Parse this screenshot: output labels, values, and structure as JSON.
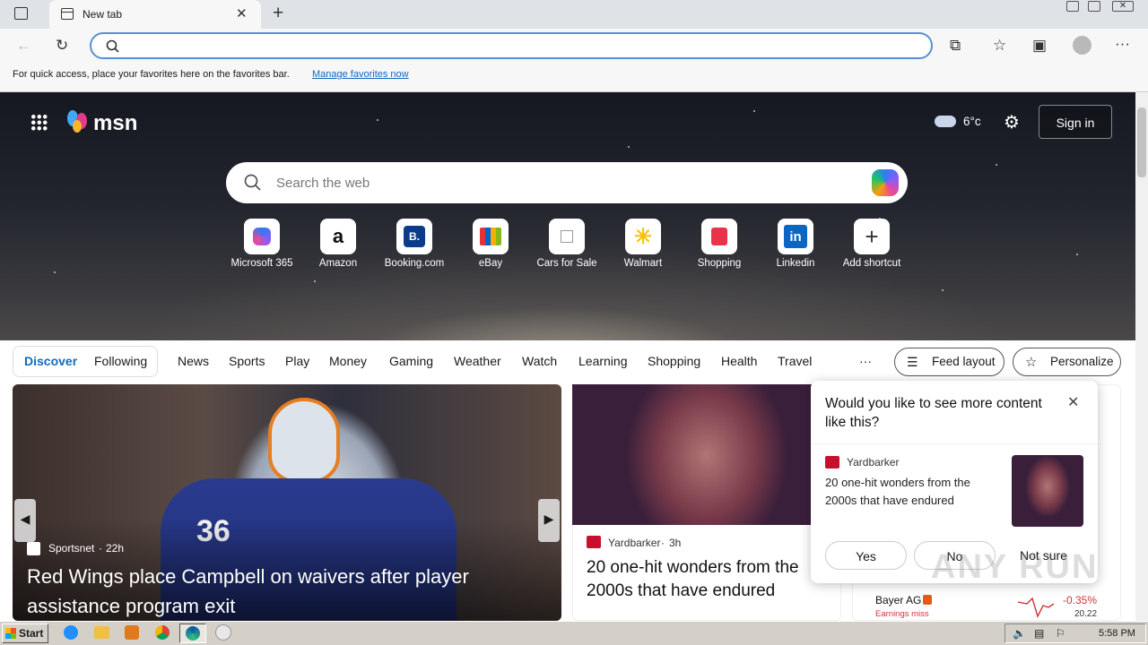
{
  "browser": {
    "tab_title": "New tab",
    "address_value": "",
    "favbar_text": "For quick access, place your favorites here on the favorites bar.",
    "favbar_link": "Manage favorites now"
  },
  "msn": {
    "logo": "msn",
    "weather": "6°c",
    "sign_in": "Sign in",
    "search_placeholder": "Search the web"
  },
  "shortcuts": [
    {
      "label": "Microsoft 365"
    },
    {
      "label": "Amazon"
    },
    {
      "label": "Booking.com"
    },
    {
      "label": "eBay"
    },
    {
      "label": "Cars for Sale"
    },
    {
      "label": "Walmart"
    },
    {
      "label": "Shopping"
    },
    {
      "label": "Linkedin"
    },
    {
      "label": "Add shortcut"
    }
  ],
  "nav": {
    "discover": "Discover",
    "following": "Following",
    "items": [
      "News",
      "Sports",
      "Play",
      "Money",
      "Gaming",
      "Weather",
      "Watch",
      "Learning",
      "Shopping",
      "Health",
      "Travel"
    ],
    "more": "···",
    "feed_layout": "Feed layout",
    "personalize": "Personalize"
  },
  "main_card": {
    "source": "Sportsnet",
    "age": "22h",
    "headline": "Red Wings place Campbell on waivers after player assistance program exit",
    "jersey": "36"
  },
  "card2": {
    "source": "Yardbarker",
    "age": "3h",
    "headline": "20 one-hit wonders from the 2000s that have endured"
  },
  "popup": {
    "question": "Would you like to see more content like this?",
    "source": "Yardbarker",
    "headline": "20 one-hit wonders from the 2000s that have endured",
    "yes": "Yes",
    "no": "No",
    "not_sure": "Not sure"
  },
  "stock": {
    "name": "Bayer AG",
    "note": "Earnings miss",
    "change": "-0.35%",
    "price": "20.22"
  },
  "watermark": "ANY RUN",
  "taskbar": {
    "start": "Start",
    "time": "5:58 PM"
  },
  "colors": {
    "accent": "#0f6cbd",
    "link": "#1565c0",
    "negative": "#d13438"
  }
}
